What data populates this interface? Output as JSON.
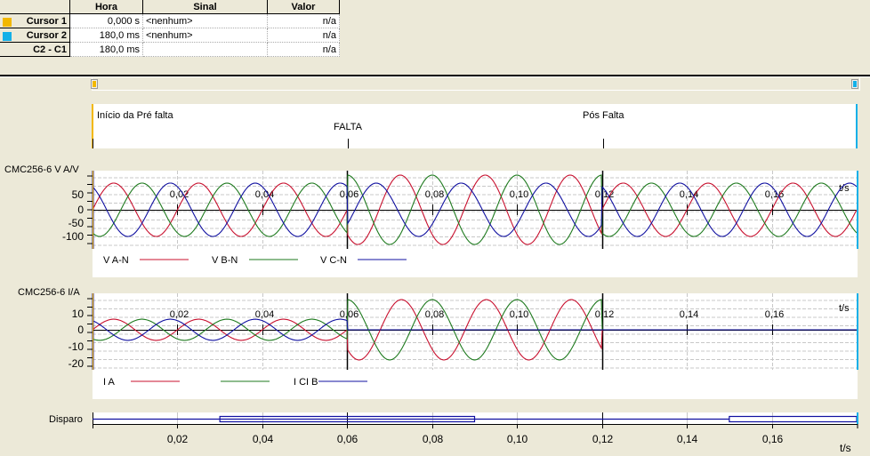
{
  "cursor_table": {
    "headers": [
      "",
      "Hora",
      "Sinal",
      "Valor"
    ],
    "rows": [
      {
        "label": "Cursor 1",
        "color": "#f2b800",
        "hora": "0,000 s",
        "sinal": "<nenhum>",
        "valor": "n/a"
      },
      {
        "label": "Cursor 2",
        "color": "#13b0e8",
        "hora": "180,0 ms",
        "sinal": "<nenhum>",
        "valor": "n/a"
      },
      {
        "label": "C2 - C1",
        "color": "",
        "hora": "180,0 ms",
        "sinal": "",
        "valor": "n/a"
      }
    ]
  },
  "events": {
    "pre_fault": "Início da Pré falta",
    "fault": "FALTA",
    "post_fault": "Pós Falta"
  },
  "colors": {
    "cursor1": "#f2b800",
    "cursor2": "#13b0e8",
    "phase_a": "#c8102e",
    "phase_b": "#1e7a1e",
    "phase_c": "#1010a0",
    "trigger": "#1010a0"
  },
  "chart_data": [
    {
      "type": "line",
      "title": "CMC256-6 V A/V",
      "xlabel": "t/s",
      "ylabel": "V",
      "xlim": [
        0,
        0.18
      ],
      "ylim": [
        -140,
        140
      ],
      "x_ticks": [
        "0,02",
        "0,04",
        "0,06",
        "0,08",
        "0,10",
        "0,12",
        "0,14",
        "0,16"
      ],
      "y_ticks": [
        "50",
        "0",
        "-50",
        "-100"
      ],
      "grid": true,
      "frequency_hz": 50,
      "segments": [
        {
          "from": 0,
          "to": 0.06,
          "name": "pre-fault",
          "amplitudes": {
            "V A-N": 100,
            "V B-N": 100,
            "V C-N": 100
          },
          "phases_deg": {
            "V A-N": 0,
            "V B-N": -120,
            "V C-N": 120
          }
        },
        {
          "from": 0.06,
          "to": 0.12,
          "name": "fault",
          "amplitudes": {
            "V A-N": 130,
            "V B-N": 130,
            "V C-N": 100
          },
          "phases_deg": {
            "V A-N": -135,
            "V B-N": 90,
            "V C-N": -33
          }
        },
        {
          "from": 0.12,
          "to": 0.18,
          "name": "post-fault",
          "amplitudes": {
            "V A-N": 100,
            "V B-N": 100,
            "V C-N": 100
          },
          "phases_deg": {
            "V A-N": 0,
            "V B-N": -120,
            "V C-N": 120
          }
        }
      ],
      "legend": [
        "V A-N",
        "V B-N",
        "V C-N"
      ],
      "legend_position": "bottom"
    },
    {
      "type": "line",
      "title": "CMC256-6 I/A",
      "xlabel": "t/s",
      "ylabel": "I",
      "xlim": [
        0,
        0.18
      ],
      "ylim": [
        -23,
        23
      ],
      "x_ticks": [
        "0,02",
        "0,04",
        "0,06",
        "0,08",
        "0,10",
        "0,12",
        "0,14",
        "0,16"
      ],
      "y_ticks": [
        "10",
        "0",
        "-10",
        "-20"
      ],
      "grid": true,
      "frequency_hz": 50,
      "segments": [
        {
          "from": 0,
          "to": 0.06,
          "name": "pre-fault",
          "amplitudes": {
            "I A": 7,
            "I B": 7,
            "I C": 7
          },
          "phases_deg": {
            "I A": 0,
            "I B": -120,
            "I C": 120
          }
        },
        {
          "from": 0.06,
          "to": 0.12,
          "name": "fault",
          "amplitudes": {
            "I A": 20,
            "I B": 20,
            "I C": 0
          },
          "phases_deg": {
            "I A": -140,
            "I B": 90,
            "I C": 0
          }
        },
        {
          "from": 0.12,
          "to": 0.18,
          "name": "post-fault",
          "amplitudes": {
            "I A": 0,
            "I B": 0,
            "I C": 0
          },
          "phases_deg": {
            "I A": 0,
            "I B": 0,
            "I C": 0
          }
        }
      ],
      "legend": [
        "I A",
        "I B",
        "I C"
      ],
      "legend_position": "bottom"
    },
    {
      "type": "line",
      "title": "Disparo",
      "xlabel": "t/s",
      "xlim": [
        0,
        0.18
      ],
      "x_ticks": [
        "0,02",
        "0,04",
        "0,06",
        "0,08",
        "0,10",
        "0,12",
        "0,14",
        "0,16"
      ],
      "active_intervals": [
        [
          0.03,
          0.09
        ],
        [
          0.15,
          0.18
        ]
      ]
    }
  ]
}
